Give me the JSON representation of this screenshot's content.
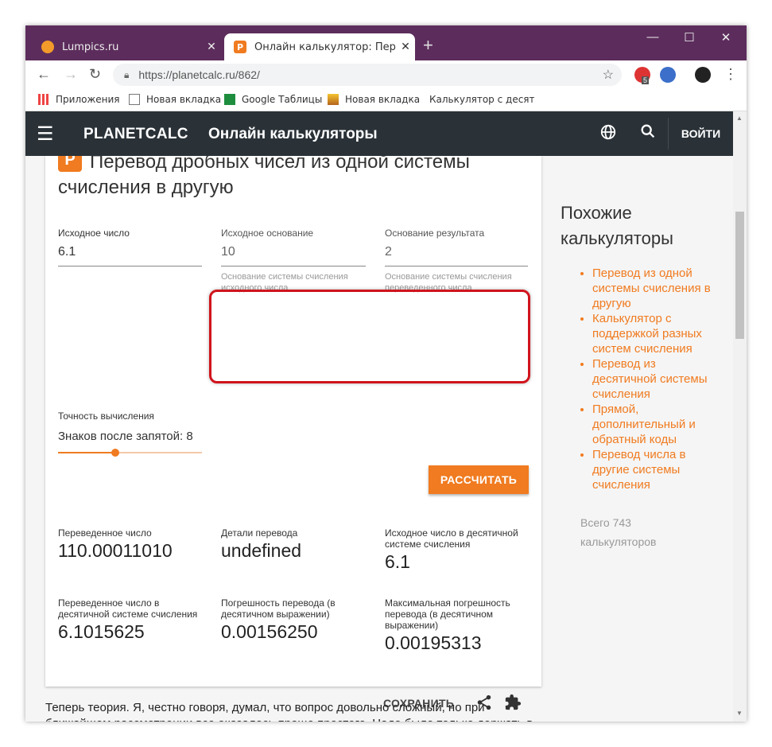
{
  "browser": {
    "tabs": [
      {
        "title": "Lumpics.ru",
        "active": false
      },
      {
        "title": "Онлайн калькулятор: Перевод д",
        "active": true
      }
    ],
    "new_tab": "+",
    "window_controls": {
      "minimize": "—",
      "maximize": "☐",
      "close": "✕"
    },
    "url": "https://planetcalc.ru/862/",
    "extension_badge": "5",
    "bookmarks": [
      {
        "label": "Приложения",
        "icon": "apps-grid-icon"
      },
      {
        "label": "Новая вкладка",
        "icon": "page-icon"
      },
      {
        "label": "Google Таблицы",
        "icon": "sheets-icon"
      },
      {
        "label": "Новая вкладка",
        "icon": "image-icon"
      },
      {
        "label": "Калькулятор с десятичн",
        "icon": "lumpics-icon"
      }
    ]
  },
  "site": {
    "brand": "PLANETCALC",
    "subtitle": "Онлайн калькуляторы",
    "login": "ВОЙТИ"
  },
  "calculator": {
    "title": "Перевод дробных чисел из одной системы счисления в другую",
    "logo_letter": "P",
    "fields": {
      "source_number": {
        "label": "Исходное число",
        "value": "6.1"
      },
      "source_base": {
        "label": "Исходное основание",
        "value": "10",
        "hint": "Основание системы счисления исходного числа"
      },
      "result_base": {
        "label": "Основание результата",
        "value": "2",
        "hint": "Основание системы счисления переведенного числа"
      }
    },
    "precision": {
      "label": "Точность вычисления",
      "value": "Знаков после запятой: 8",
      "slider_fraction": 0.4
    },
    "calc_button": "РАССЧИТАТЬ",
    "results": [
      {
        "label": "Переведенное число",
        "value": "110.00011010"
      },
      {
        "label": "Детали перевода",
        "value": "undefined"
      },
      {
        "label": "Исходное число в десятичной системе счисления",
        "value": "6.1"
      },
      {
        "label": "Переведенное число в десятичной системе счисления",
        "value": "6.1015625"
      },
      {
        "label": "Погрешность перевода (в десятичном выражении)",
        "value": "0.00156250"
      },
      {
        "label": "Максимальная погрешность перевода (в десятичном выражении)",
        "value": "0.00195313"
      }
    ],
    "save": "СОХРАНИТЬ"
  },
  "sidebar": {
    "heading": "Похожие калькуляторы",
    "links": [
      "Перевод из одной системы счисления в другую",
      "Калькулятор с поддержкой разных систем счисления",
      "Перевод из десятичной системы счисления",
      "Прямой, дополнительный и обратный коды",
      "Перевод числа в другие системы счисления"
    ],
    "total": "Всего 743 калькуляторов"
  },
  "theory": "Теперь теория. Я, честно говоря, думал, что вопрос довольно сложный, но при ближайшем рассмотрении все оказалось проще простого. Надо было только держать в голове тот факт, что речь идет о позиционных системах счисления.",
  "colors": {
    "accent": "#f07b20",
    "appbar": "#2a3238",
    "tabbar": "#5c2d5c",
    "highlight": "#d0141c"
  }
}
